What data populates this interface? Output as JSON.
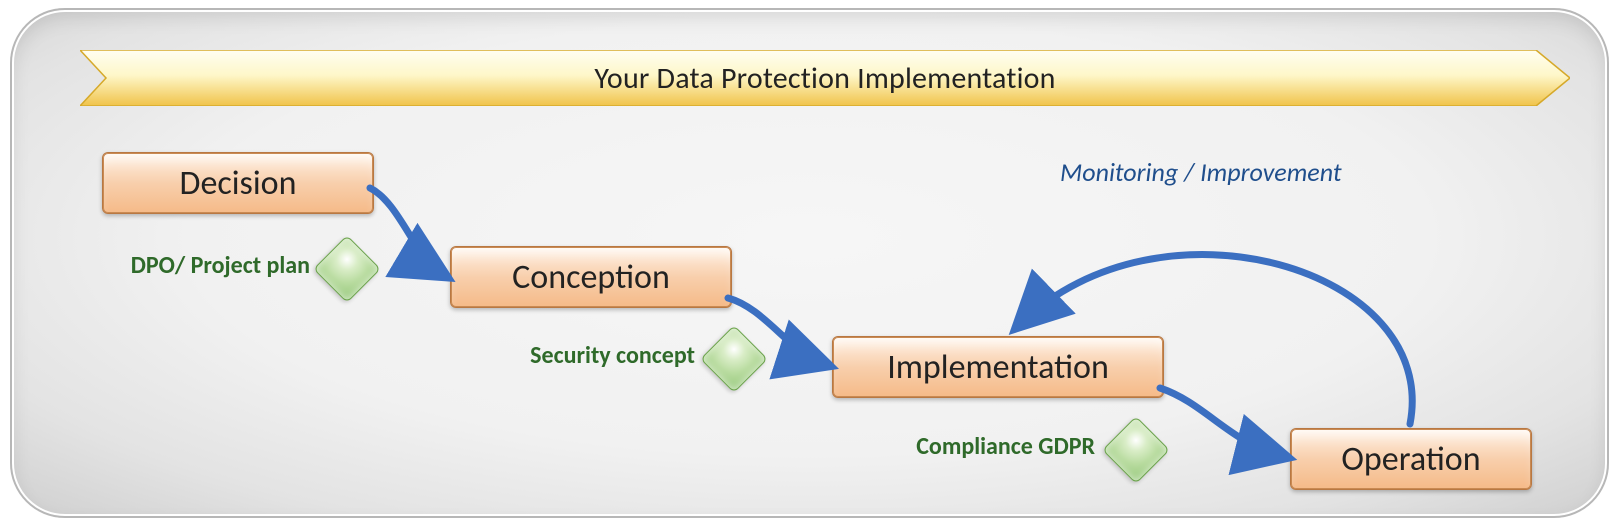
{
  "banner": {
    "title": "Your Data Protection Implementation"
  },
  "stages": {
    "decision": "Decision",
    "conception": "Conception",
    "implementation": "Implementation",
    "operation": "Operation"
  },
  "milestones": {
    "m1": "DPO/ Project plan",
    "m2": "Security concept",
    "m3": "Compliance GDPR"
  },
  "feedback_label": "Monitoring / Improvement",
  "colors": {
    "arrow": "#3b6fc1",
    "milestone_text": "#2f6a2a",
    "stage_fill_top": "#fff2e6",
    "stage_fill_bottom": "#f5ba88",
    "banner_gold_light": "#fffde5",
    "banner_gold_dark": "#f1c44a"
  }
}
